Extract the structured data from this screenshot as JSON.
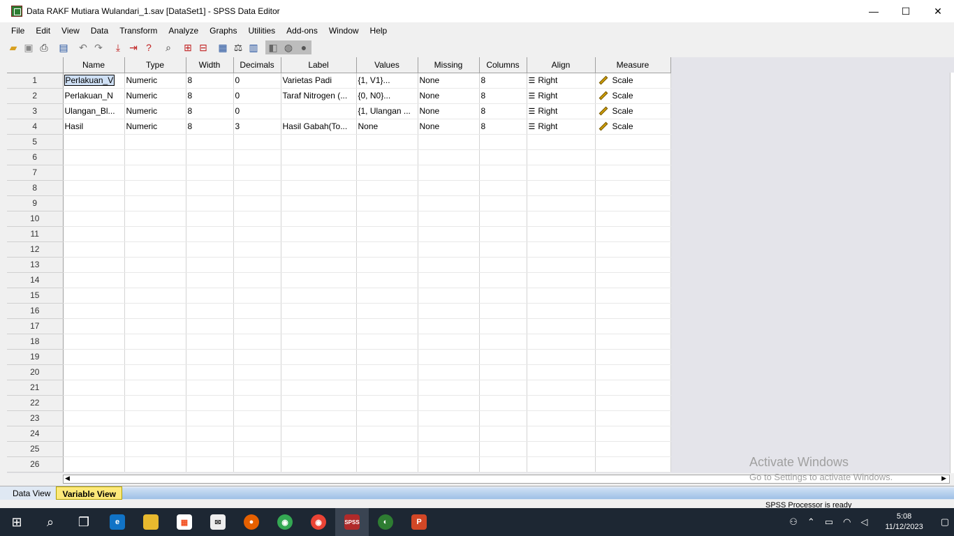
{
  "window": {
    "title": "Data RAKF Mutiara Wulandari_1.sav [DataSet1] - SPSS Data Editor",
    "minimize": "—",
    "maximize": "☐",
    "close": "✕"
  },
  "menu": [
    "File",
    "Edit",
    "View",
    "Data",
    "Transform",
    "Analyze",
    "Graphs",
    "Utilities",
    "Add-ons",
    "Window",
    "Help"
  ],
  "toolbar_icons": [
    "open-folder",
    "save",
    "print",
    "dialog-recall",
    "undo",
    "redo",
    "goto-case",
    "goto-variable",
    "variables",
    "find",
    "insert-cases",
    "insert-variable",
    "split-file",
    "weight-cases",
    "select-cases",
    "value-labels",
    "use-sets",
    "show-all-variables"
  ],
  "columns": [
    "Name",
    "Type",
    "Width",
    "Decimals",
    "Label",
    "Values",
    "Missing",
    "Columns",
    "Align",
    "Measure"
  ],
  "rows": [
    {
      "num": "1",
      "name": "Perlakuan_V",
      "type": "Numeric",
      "width": "8",
      "decimals": "0",
      "label": "Varietas Padi",
      "values": "{1, V1}...",
      "missing": "None",
      "columns": "8",
      "align": "Right",
      "measure": "Scale"
    },
    {
      "num": "2",
      "name": "Perlakuan_N",
      "type": "Numeric",
      "width": "8",
      "decimals": "0",
      "label": "Taraf Nitrogen (...",
      "values": "{0, N0}...",
      "missing": "None",
      "columns": "8",
      "align": "Right",
      "measure": "Scale"
    },
    {
      "num": "3",
      "name": "Ulangan_Bl...",
      "type": "Numeric",
      "width": "8",
      "decimals": "0",
      "label": "",
      "values": "{1, Ulangan ...",
      "missing": "None",
      "columns": "8",
      "align": "Right",
      "measure": "Scale"
    },
    {
      "num": "4",
      "name": "Hasil",
      "type": "Numeric",
      "width": "8",
      "decimals": "3",
      "label": "Hasil Gabah(To...",
      "values": "None",
      "missing": "None",
      "columns": "8",
      "align": "Right",
      "measure": "Scale"
    }
  ],
  "empty_rows": [
    "5",
    "6",
    "7",
    "8",
    "9",
    "10",
    "11",
    "12",
    "13",
    "14",
    "15",
    "16",
    "17",
    "18",
    "19",
    "20",
    "21",
    "22",
    "23",
    "24",
    "25",
    "26"
  ],
  "tabs": {
    "data_view": "Data View",
    "variable_view": "Variable View"
  },
  "status": "SPSS  Processor is ready",
  "watermark": {
    "line1": "Activate Windows",
    "line2": "Go to Settings to activate Windows."
  },
  "taskbar": {
    "apps": [
      "start",
      "search",
      "task-view",
      "edge",
      "file-explorer",
      "store",
      "mail",
      "firefox",
      "chrome",
      "chrome-profile",
      "spss",
      "app-globe",
      "powerpoint"
    ],
    "spss_label": "SPSS",
    "time": "5:08",
    "date": "11/12/2023"
  }
}
